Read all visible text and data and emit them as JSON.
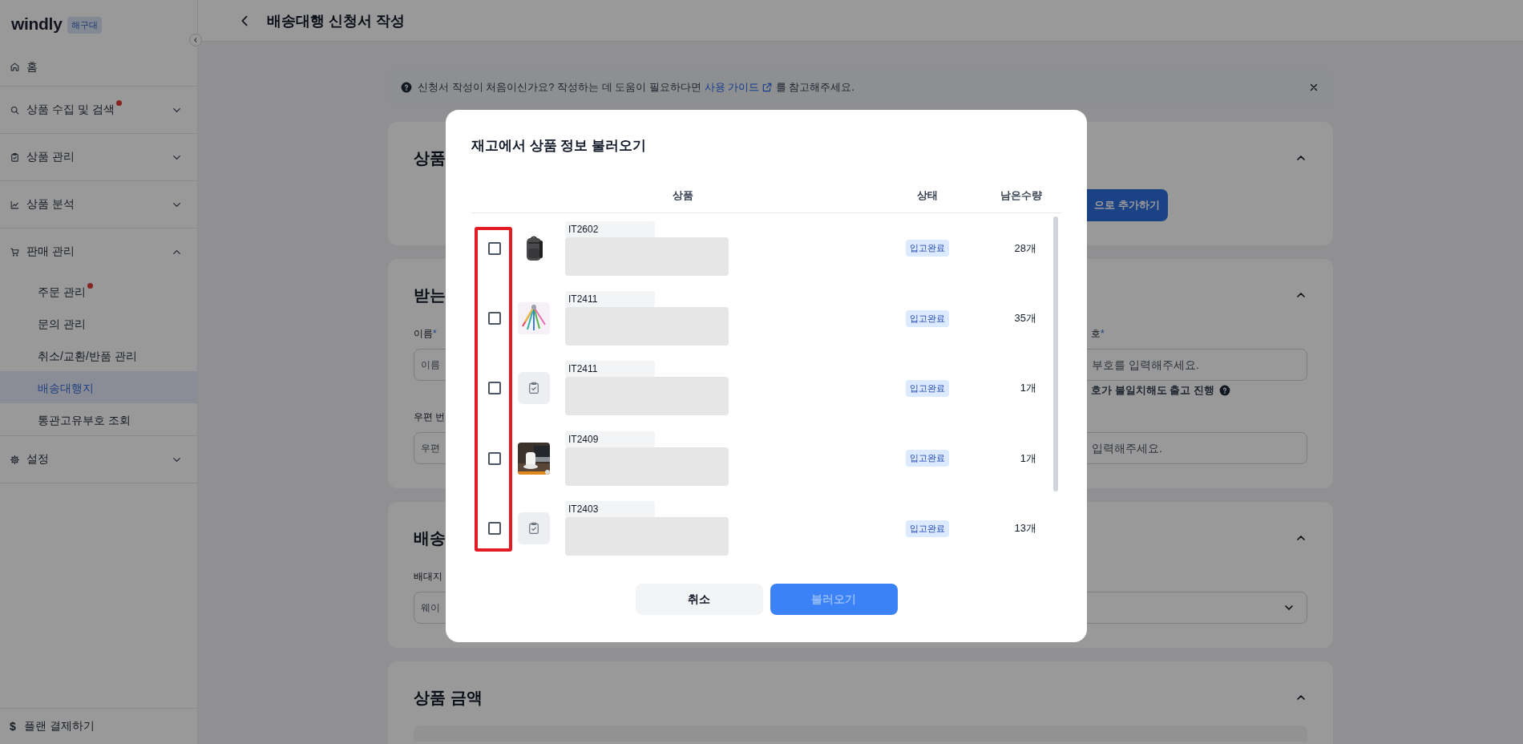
{
  "sidebar": {
    "logo": "windly",
    "badge": "해구대",
    "items": [
      {
        "label": "홈",
        "dot": false,
        "selected": false
      },
      {
        "label": "상품 수집 및 검색",
        "dot": true,
        "selected": false,
        "expanded": false
      },
      {
        "label": "상품 관리",
        "dot": false,
        "selected": false,
        "expanded": false
      },
      {
        "label": "상품 분석",
        "dot": false,
        "selected": false,
        "expanded": false
      },
      {
        "label": "판매 관리",
        "dot": false,
        "selected": false,
        "expanded": true,
        "children": [
          {
            "label": "주문 관리",
            "dot": true,
            "selected": false
          },
          {
            "label": "문의 관리",
            "dot": false,
            "selected": false
          },
          {
            "label": "취소/교환/반품 관리",
            "dot": false,
            "selected": false
          },
          {
            "label": "배송대행지",
            "dot": false,
            "selected": true
          },
          {
            "label": "통관고유부호 조회",
            "dot": false,
            "selected": false
          }
        ]
      },
      {
        "label": "설정",
        "dot": false,
        "selected": false,
        "expanded": false
      }
    ],
    "footer": {
      "icon": "$",
      "label": "플랜 결제하기"
    }
  },
  "header": {
    "title": "배송대행 신청서 작성"
  },
  "banner": {
    "text": "신청서 작성이 처음이신가요? 작성하는 데 도움이 필요하다면",
    "link": "사용 가이드",
    "text_after": "를 참고해주세요."
  },
  "sections": [
    {
      "title": "상품",
      "expanded": true,
      "button": "으로 추가하기"
    },
    {
      "title": "받는",
      "expanded": true,
      "fields": [
        {
          "kind": "text",
          "label": "이름",
          "asterisk": "*",
          "placeholder": "이름"
        },
        {
          "kind": "text",
          "label": "호",
          "asterisk": "*",
          "placeholder": "부호를 입력해주세요.",
          "note": "호가 불일치해도 출고 진행"
        },
        {
          "kind": "text",
          "label": "우편 번",
          "placeholder": "우편"
        },
        {
          "kind": "text",
          "placeholder": "입력해주세요."
        }
      ]
    },
    {
      "title": "배송",
      "expanded": true,
      "fields": [
        {
          "kind": "select",
          "label": "배대지",
          "placeholder": "웨이"
        }
      ]
    },
    {
      "title": "상품 금액",
      "expanded": true,
      "panel": true
    }
  ],
  "modal": {
    "open": true,
    "title": "재고에서 상품 정보 불러오기",
    "columns": [
      "상품",
      "상태",
      "남은수량"
    ],
    "checkbox_column_highlighted": true,
    "rows": [
      {
        "checked": false,
        "code": "IT2602",
        "status": "입고완료",
        "quantity": "28개"
      },
      {
        "checked": false,
        "code": "IT2411",
        "status": "입고완료",
        "quantity": "35개"
      },
      {
        "checked": false,
        "thumbnail": {
          "kind": "placeholder"
        },
        "code": "IT2411",
        "status": "입고완료",
        "quantity": "1개"
      },
      {
        "checked": false,
        "code": "IT2409",
        "status": "입고완료",
        "quantity": "1개"
      },
      {
        "checked": false,
        "thumbnail": {
          "kind": "placeholder"
        },
        "code": "IT2403",
        "status": "입고완료",
        "quantity": "13개"
      }
    ],
    "buttons": [
      {
        "kind": "secondary",
        "label": "취소",
        "disabled": false
      },
      {
        "kind": "primary",
        "label": "불러오기",
        "disabled": true
      }
    ]
  }
}
